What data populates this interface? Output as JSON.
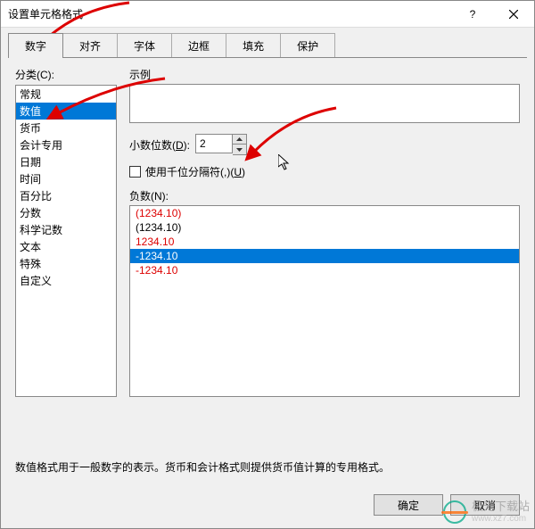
{
  "title": "设置单元格格式",
  "question_icon": "?",
  "tabs": [
    "数字",
    "对齐",
    "字体",
    "边框",
    "填充",
    "保护"
  ],
  "active_tab": 0,
  "category": {
    "label": "分类(C):",
    "items": [
      "常规",
      "数值",
      "货币",
      "会计专用",
      "日期",
      "时间",
      "百分比",
      "分数",
      "科学记数",
      "文本",
      "特殊",
      "自定义"
    ],
    "selected": 1
  },
  "sample_label": "示例",
  "decimal": {
    "label_pre": "小数位数(",
    "label_u": "D",
    "label_post": "):",
    "value": "2"
  },
  "thousand": {
    "label_pre": "使用千位分隔符(,)(",
    "label_u": "U",
    "label_post": ")",
    "checked": false
  },
  "negative": {
    "label": "负数(N):",
    "items": [
      {
        "text": "(1234.10)",
        "red": true
      },
      {
        "text": "(1234.10)",
        "red": false
      },
      {
        "text": "1234.10",
        "red": true
      },
      {
        "text": "-1234.10",
        "red": false
      },
      {
        "text": "-1234.10",
        "red": true
      }
    ],
    "selected": 3
  },
  "description": "数值格式用于一般数字的表示。货币和会计格式则提供货币值计算的专用格式。",
  "buttons": {
    "ok": "确定",
    "cancel": "取消"
  },
  "watermark": {
    "line1": "极光下载站",
    "line2": "www.xz7.com"
  }
}
